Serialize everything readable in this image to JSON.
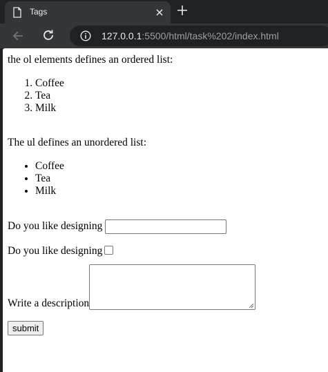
{
  "browser": {
    "tab_title": "Tags",
    "url_host": "127.0.0.1",
    "url_rest": ":5500/html/task%202/index.html"
  },
  "page": {
    "ol_intro": "the ol elements defines an ordered list:",
    "ordered_items": [
      "Coffee",
      "Tea",
      "Milk"
    ],
    "ul_intro": "The ul defines an unordered list:",
    "unordered_items": [
      "Coffee",
      "Tea",
      "Milk"
    ],
    "form": {
      "text_label": "Do you like designing",
      "text_value": "",
      "checkbox_label": "Do you like designing",
      "checkbox_checked": false,
      "textarea_label": "Write a description",
      "textarea_value": "",
      "submit_label": "submit"
    }
  }
}
